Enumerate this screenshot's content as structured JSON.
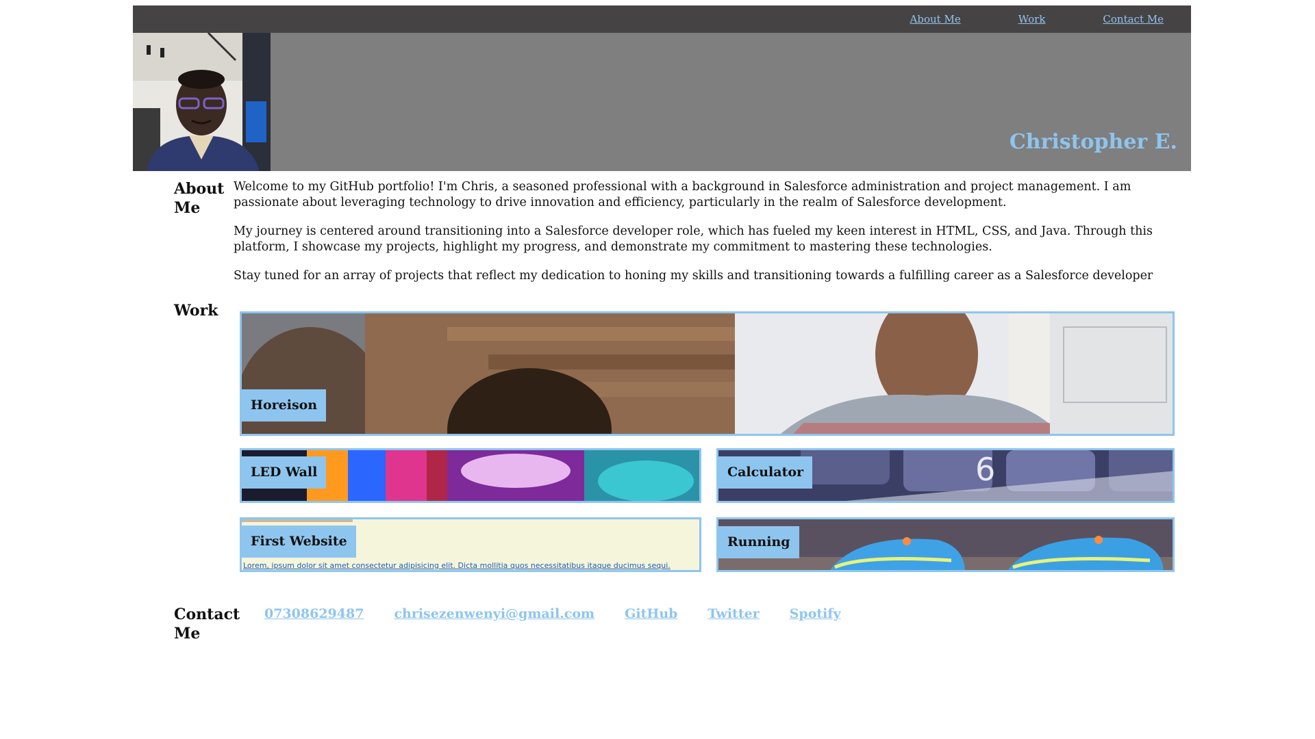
{
  "nav": {
    "items": [
      {
        "label": "About Me"
      },
      {
        "label": "Work"
      },
      {
        "label": "Contact Me"
      }
    ]
  },
  "hero": {
    "name": "Christopher E."
  },
  "about": {
    "title": "About Me",
    "paragraphs": [
      "Welcome to my GitHub portfolio! I'm Chris, a seasoned professional with a background in Salesforce administration and project management. I am passionate about leveraging technology to drive innovation and efficiency, particularly in the realm of Salesforce development.",
      "My journey is centered around transitioning into a Salesforce developer role, which has fueled my keen interest in HTML, CSS, and Java. Through this platform, I showcase my projects, highlight my progress, and demonstrate my commitment to mastering these technologies.",
      "Stay tuned for an array of projects that reflect my dedication to honing my skills and transitioning towards a fulfilling career as a Salesforce developer"
    ]
  },
  "work": {
    "title": "Work",
    "projects": [
      {
        "label": "Horeison"
      },
      {
        "label": "LED Wall"
      },
      {
        "label": "Calculator"
      },
      {
        "label": "First Website",
        "caption": "Lorem, ipsum dolor sit amet consectetur adipisicing elit. Dicta mollitia quos necessitatibus itaque ducimus sequi."
      },
      {
        "label": "Running"
      }
    ]
  },
  "contact": {
    "title": "Contact Me",
    "links": [
      {
        "label": "07308629487"
      },
      {
        "label": "chrisezenwenyi@gmail.com"
      },
      {
        "label": "GitHub"
      },
      {
        "label": "Twitter"
      },
      {
        "label": "Spotify"
      }
    ]
  },
  "colors": {
    "nav_bg": "#464344",
    "hero_bg": "#7f7f7f",
    "accent": "#8ec5ee"
  }
}
